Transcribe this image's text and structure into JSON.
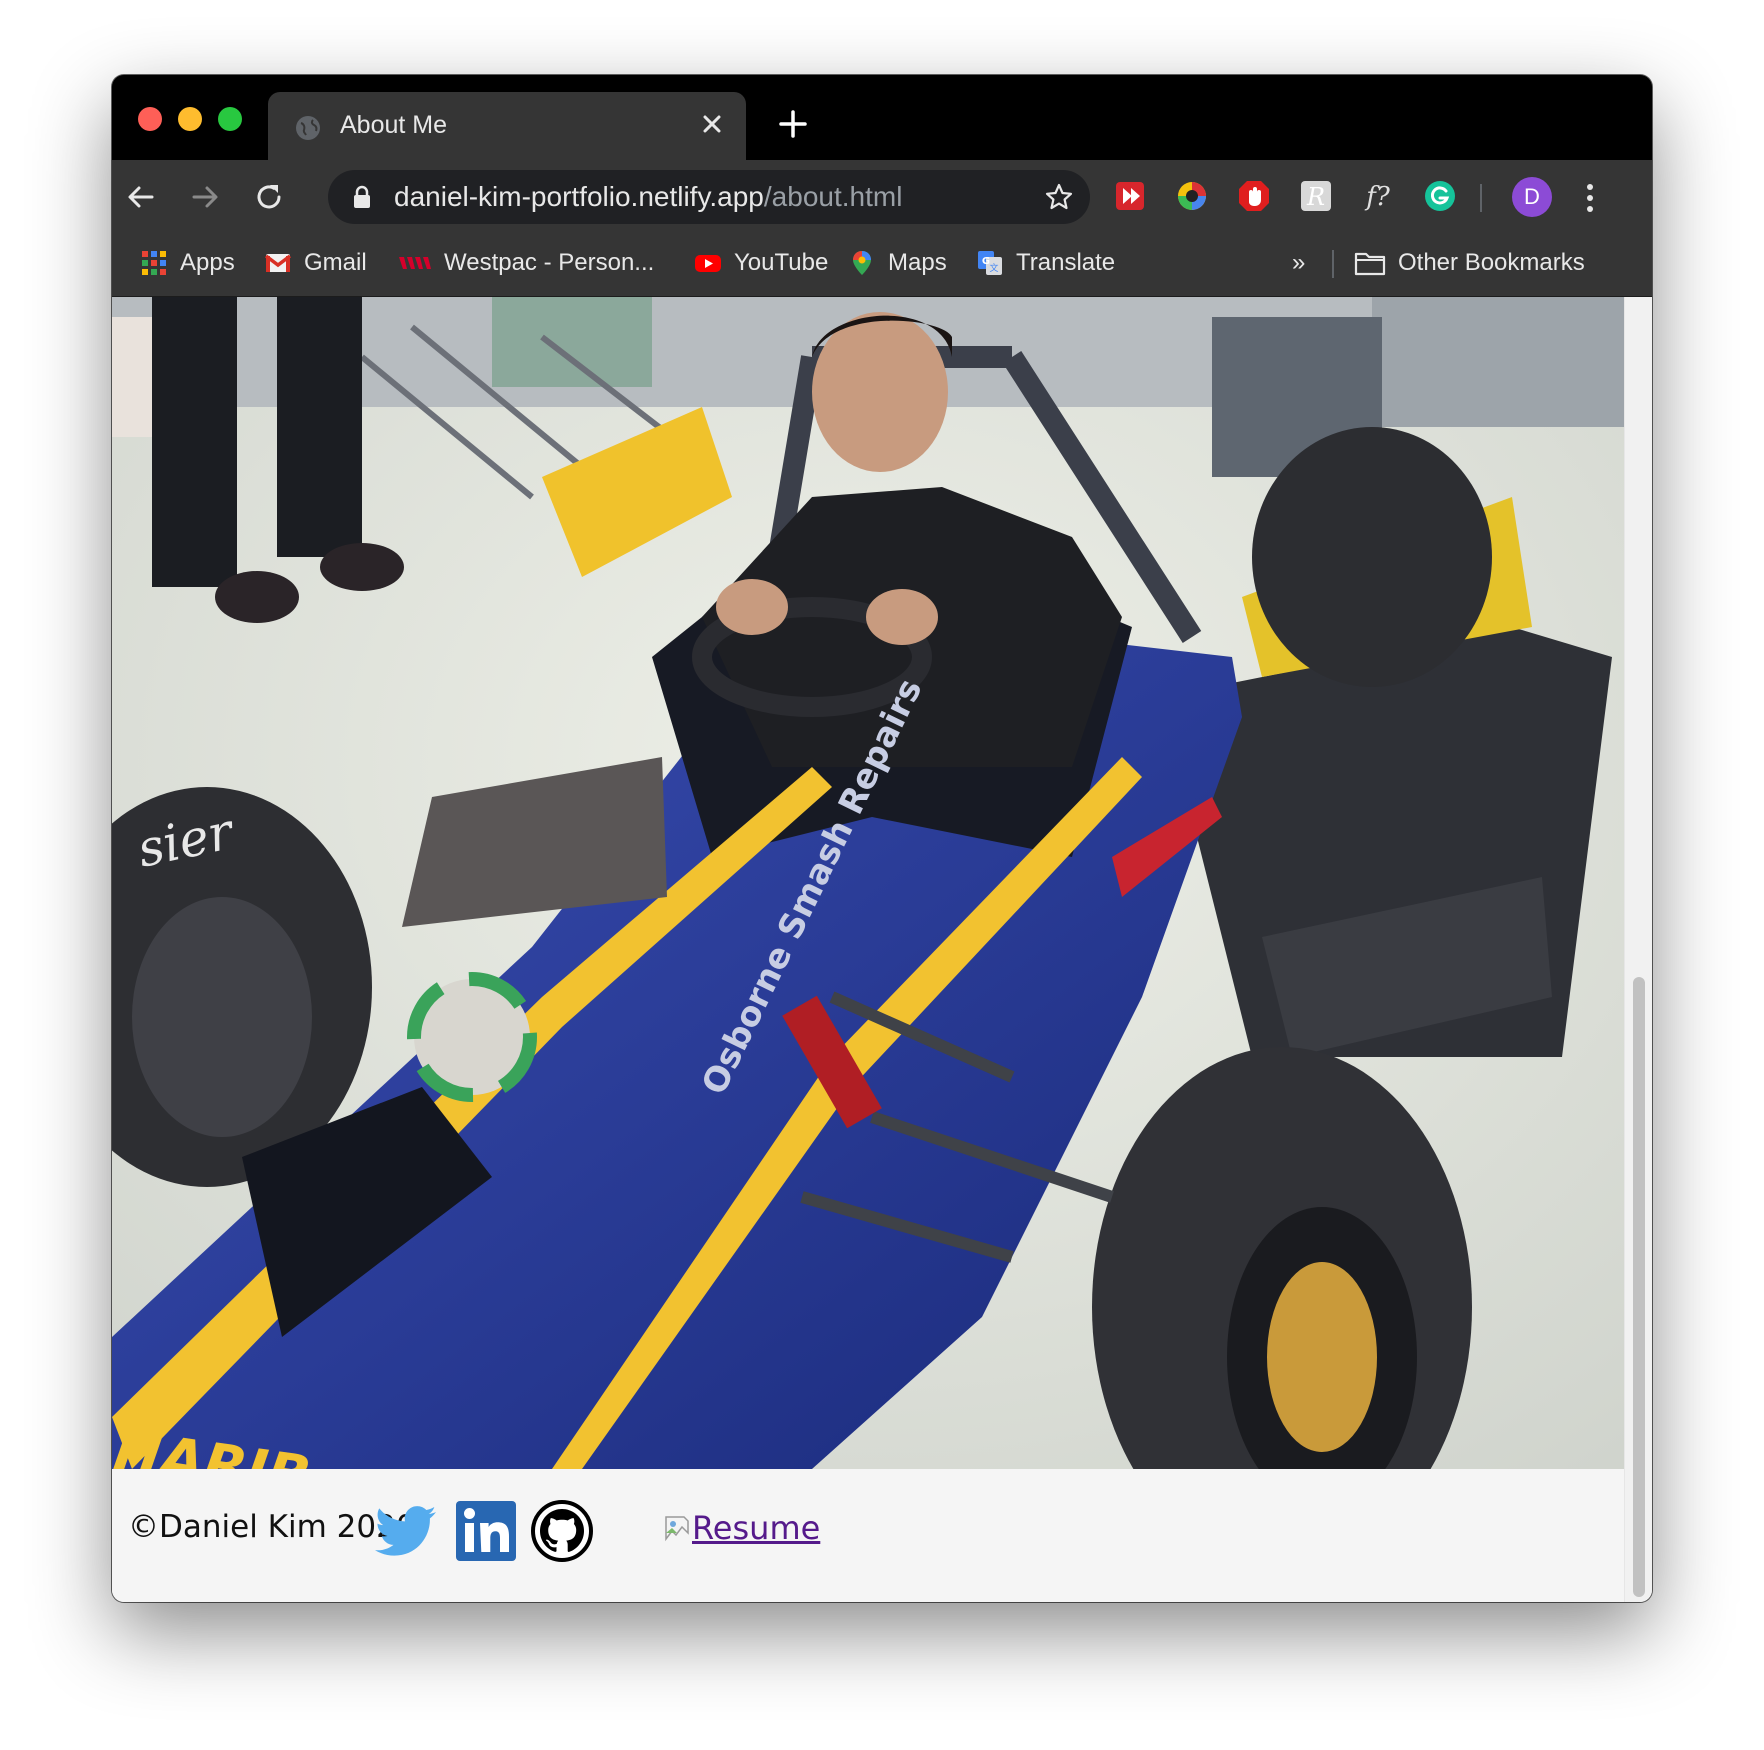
{
  "window": {
    "tab": {
      "title": "About Me"
    },
    "toolbar": {
      "url_host": "daniel-kim-portfolio.netlify.app",
      "url_path": "/about.html",
      "avatar_letter": "D",
      "extensions": [
        "sharing-extension-icon",
        "color-picker-icon",
        "adblock-icon",
        "readwise-icon",
        "whatfont-icon",
        "grammarly-icon"
      ]
    },
    "bookmarks": [
      {
        "label": "Apps",
        "icon": "apps-grid-icon"
      },
      {
        "label": "Gmail",
        "icon": "gmail-icon"
      },
      {
        "label": "Westpac - Person...",
        "icon": "westpac-icon"
      },
      {
        "label": "YouTube",
        "icon": "youtube-icon"
      },
      {
        "label": "Maps",
        "icon": "maps-icon"
      },
      {
        "label": "Translate",
        "icon": "translate-icon"
      }
    ],
    "bookmarks_overflow": "»",
    "other_bookmarks": "Other Bookmarks"
  },
  "page": {
    "footer": {
      "copyright": "©Daniel Kim 2020",
      "social": [
        "twitter-icon",
        "linkedin-icon",
        "github-icon"
      ],
      "resume_link": "Resume"
    }
  },
  "colors": {
    "twitter": "#55acee",
    "linkedin": "#2867b2",
    "link": "#551a8b",
    "tabbar": "#000000",
    "toolbar": "#353535"
  }
}
